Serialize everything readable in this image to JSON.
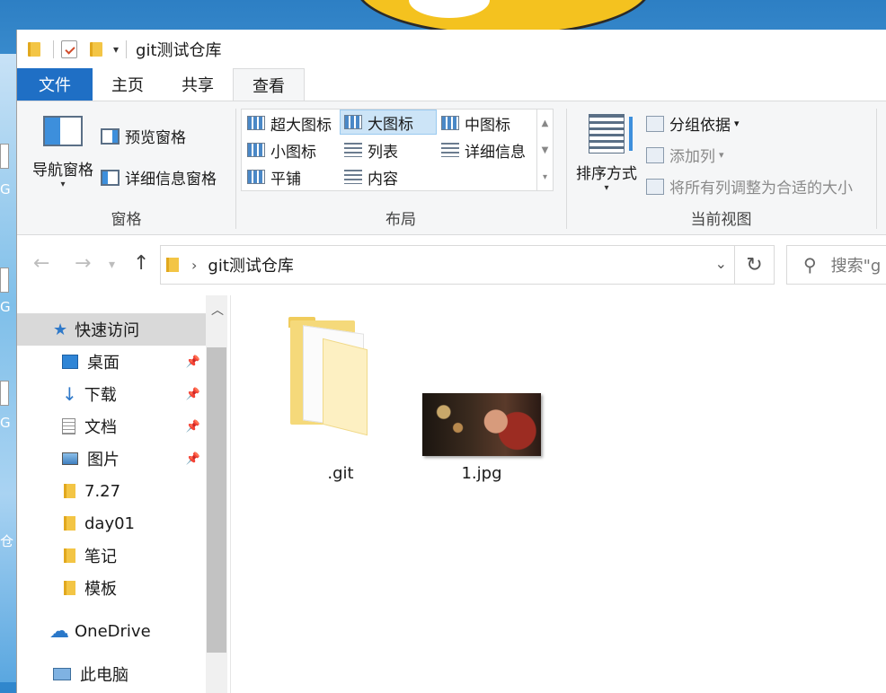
{
  "desktop": {
    "labels": [
      "G",
      "G",
      "G",
      "仓"
    ]
  },
  "window": {
    "title": "git测试仓库"
  },
  "tabs": [
    {
      "label": "文件"
    },
    {
      "label": "主页"
    },
    {
      "label": "共享"
    },
    {
      "label": "查看"
    }
  ],
  "ribbon": {
    "panes": {
      "label": "窗格",
      "nav_pane": "导航窗格",
      "preview_pane": "预览窗格",
      "details_pane": "详细信息窗格"
    },
    "layout": {
      "label": "布局",
      "items": [
        "超大图标",
        "大图标",
        "中图标",
        "小图标",
        "列表",
        "详细信息",
        "平铺",
        "内容"
      ],
      "selected": "大图标"
    },
    "current_view": {
      "label": "当前视图",
      "sort_by": "排序方式",
      "group_by": "分组依据",
      "add_column": "添加列",
      "fit_columns": "将所有列调整为合适的大小"
    }
  },
  "address": {
    "path": "git测试仓库",
    "search_placeholder": "搜索\"g"
  },
  "navpane": {
    "quick_access": "快速访问",
    "items": [
      {
        "label": "桌面",
        "pinned": true
      },
      {
        "label": "下载",
        "pinned": true
      },
      {
        "label": "文档",
        "pinned": true
      },
      {
        "label": "图片",
        "pinned": true
      },
      {
        "label": "7.27",
        "pinned": false
      },
      {
        "label": "day01",
        "pinned": false
      },
      {
        "label": "笔记",
        "pinned": false
      },
      {
        "label": "模板",
        "pinned": false
      }
    ],
    "onedrive": "OneDrive",
    "this_pc": "此电脑"
  },
  "files": [
    {
      "name": ".git",
      "type": "folder"
    },
    {
      "name": "1.jpg",
      "type": "image"
    }
  ],
  "icons": {
    "pin": "pin-icon",
    "star": "star-icon",
    "refresh": "refresh-icon",
    "search": "search-icon"
  },
  "colors": {
    "file_tab": "#1f6fc5",
    "selection": "#cce4f7",
    "folder": "#f3c545"
  }
}
